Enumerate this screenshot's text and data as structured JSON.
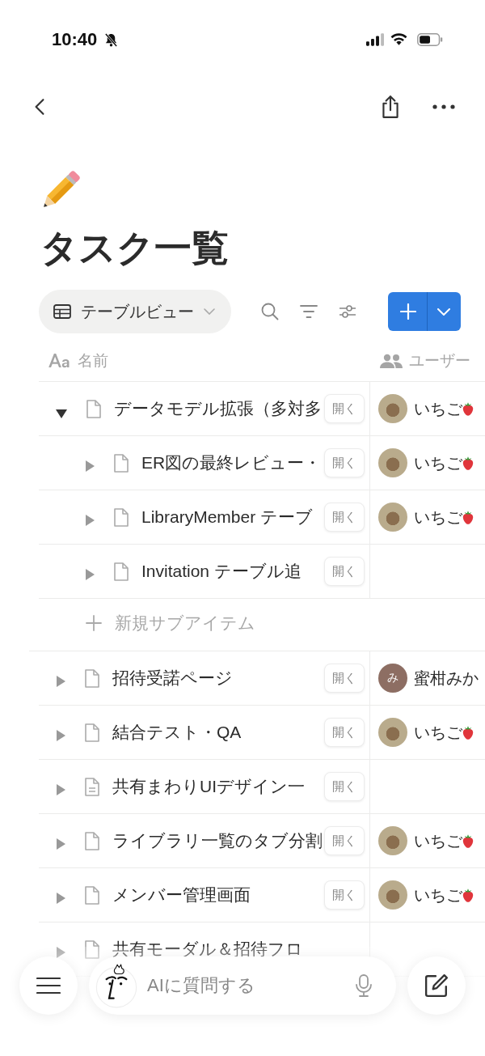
{
  "status_bar": {
    "time": "10:40"
  },
  "page": {
    "title": "タスク一覧"
  },
  "toolbar": {
    "view_label": "テーブルビュー"
  },
  "table": {
    "columns": [
      {
        "label": "名前",
        "kind": "title"
      },
      {
        "label": "ユーザー",
        "kind": "person"
      }
    ],
    "rows": [
      {
        "name": "データモデル拡張（多対多",
        "kind": "page",
        "expanded": true,
        "open_label": "開く",
        "user": {
          "name": "いちご",
          "kind": "photo"
        },
        "add_label": "新規サブアイテム",
        "children": [
          {
            "name": "ER図の最終レビュー・",
            "kind": "page",
            "expanded": false,
            "open_label": "開く",
            "user": {
              "name": "いちご",
              "kind": "photo"
            }
          },
          {
            "name": "LibraryMember テーブ",
            "kind": "page",
            "expanded": false,
            "open_label": "開く",
            "user": {
              "name": "いちご",
              "kind": "photo"
            }
          },
          {
            "name": "Invitation テーブル追",
            "kind": "page",
            "expanded": false,
            "open_label": "開く"
          }
        ]
      },
      {
        "name": "招待受諾ページ",
        "kind": "page",
        "expanded": false,
        "open_label": "開く",
        "user": {
          "name": "蜜柑みか",
          "kind": "initial",
          "initial": "み"
        }
      },
      {
        "name": "結合テスト・QA",
        "kind": "page",
        "expanded": false,
        "open_label": "開く",
        "user": {
          "name": "いちご",
          "kind": "photo"
        }
      },
      {
        "name": "共有まわりUIデザイン一",
        "kind": "doc",
        "expanded": false,
        "open_label": "開く"
      },
      {
        "name": "ライブラリ一覧のタブ分割",
        "kind": "page",
        "expanded": false,
        "open_label": "開く",
        "user": {
          "name": "いちご",
          "kind": "photo"
        }
      },
      {
        "name": "メンバー管理画面",
        "kind": "page",
        "expanded": false,
        "open_label": "開く",
        "user": {
          "name": "いちご",
          "kind": "photo"
        }
      },
      {
        "name": "共有モーダル＆招待フロ",
        "kind": "page",
        "expanded": false
      }
    ]
  },
  "ai_bar": {
    "placeholder": "AIに質問する"
  }
}
